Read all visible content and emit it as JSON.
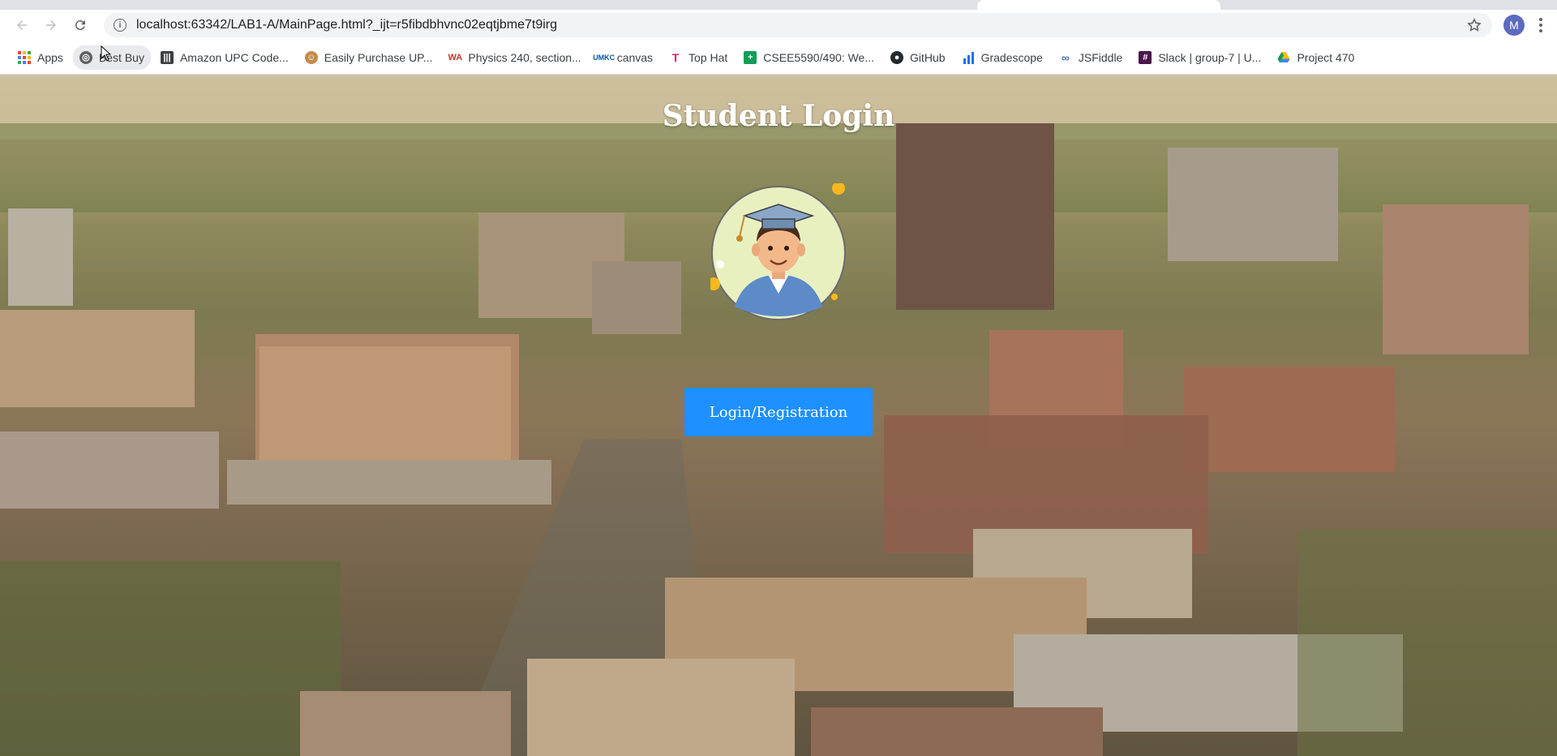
{
  "browser": {
    "url": "localhost:63342/LAB1-A/MainPage.html?_ijt=r5fibdbhvnc02eqtjbme7t9irg",
    "profile_initial": "M",
    "bookmarks": [
      {
        "label": "Apps",
        "icon": "apps-grid-icon"
      },
      {
        "label": "Best Buy",
        "icon": "globe-icon"
      },
      {
        "label": "Amazon UPC Code...",
        "icon": "barcode-icon"
      },
      {
        "label": "Easily Purchase UP...",
        "icon": "face-icon"
      },
      {
        "label": "Physics 240, section...",
        "icon": "webassign-icon"
      },
      {
        "label": "canvas",
        "icon": "umkc-icon"
      },
      {
        "label": "Top Hat",
        "icon": "tophat-icon"
      },
      {
        "label": "CSEE5590/490: We...",
        "icon": "sheets-icon"
      },
      {
        "label": "GitHub",
        "icon": "github-icon"
      },
      {
        "label": "Gradescope",
        "icon": "bar-chart-icon"
      },
      {
        "label": "JSFiddle",
        "icon": "jsfiddle-icon"
      },
      {
        "label": "Slack | group-7 | U...",
        "icon": "slack-icon"
      },
      {
        "label": "Project 470",
        "icon": "drive-icon"
      }
    ]
  },
  "page": {
    "title": "Student Login",
    "login_button": "Login/Registration",
    "avatar_icon": "student-graduate-avatar-icon",
    "button_color": "#1e90ff"
  }
}
